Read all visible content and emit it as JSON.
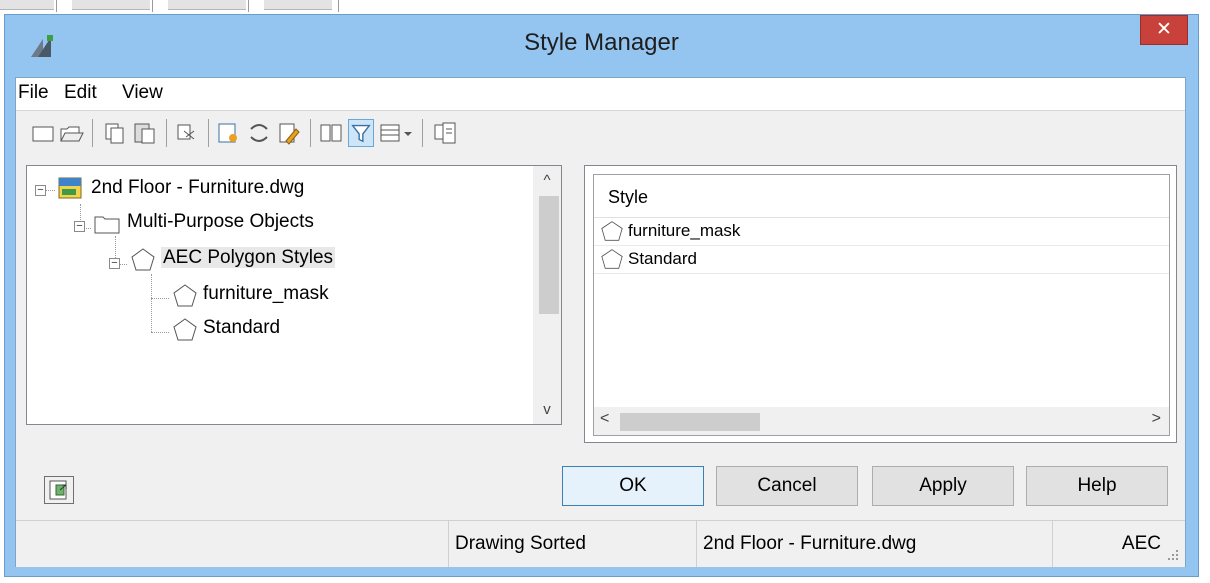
{
  "window": {
    "title": "Style Manager",
    "close_glyph": "✕"
  },
  "menu": {
    "items": [
      "File",
      "Edit",
      "View"
    ]
  },
  "toolbar": {
    "buttons": [
      "new-icon",
      "open-icon",
      "copy-icon",
      "paste-icon",
      "purge-icon",
      "new-style-icon",
      "set-from-icon",
      "edit-style-icon",
      "toggle-view-icon",
      "filter-icon",
      "view-options-icon",
      "inline-edit-icon"
    ],
    "active": "filter-icon"
  },
  "tree": {
    "nodes": [
      {
        "label": "2nd Floor - Furniture.dwg",
        "icon": "drawing-file-icon",
        "expanded": true
      },
      {
        "label": "Multi-Purpose Objects",
        "icon": "folder-icon",
        "expanded": true
      },
      {
        "label": "AEC Polygon Styles",
        "icon": "polygon-icon",
        "expanded": true,
        "selected": true
      },
      {
        "label": "furniture_mask",
        "icon": "polygon-icon"
      },
      {
        "label": "Standard",
        "icon": "polygon-icon"
      }
    ],
    "scroll_up": "^",
    "scroll_down": "v"
  },
  "list": {
    "column_header": "Style",
    "rows": [
      "furniture_mask",
      "Standard"
    ],
    "scroll_left": "<",
    "scroll_right": ">"
  },
  "buttons": {
    "ok": "OK",
    "cancel": "Cancel",
    "apply": "Apply",
    "help": "Help"
  },
  "status": {
    "sort": "Drawing Sorted",
    "file": "2nd Floor - Furniture.dwg",
    "mode": "AEC"
  }
}
